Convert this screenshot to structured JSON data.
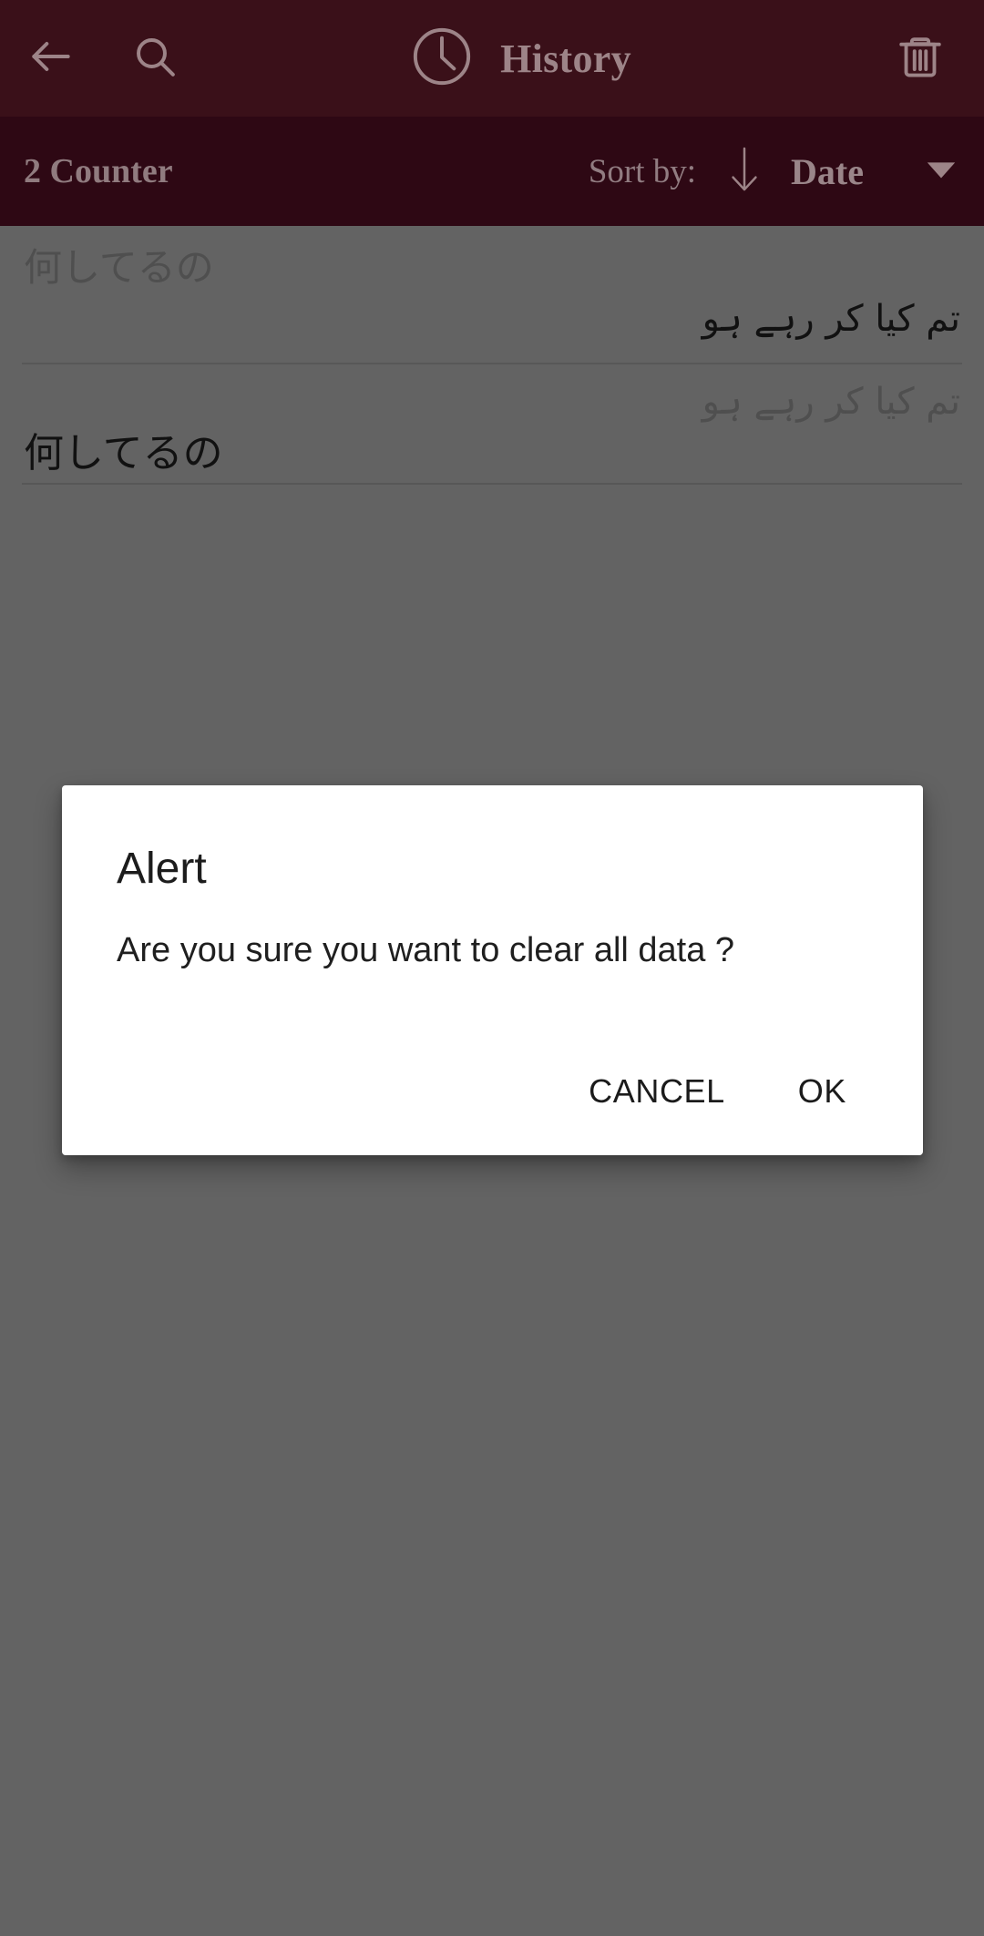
{
  "appbar": {
    "back_icon": "arrow-left-icon",
    "search_icon": "search-icon",
    "clock_icon": "clock-icon",
    "title": "History",
    "delete_icon": "trash-icon",
    "background_color": "#3a1019",
    "foreground_color": "#9d8488"
  },
  "sortbar": {
    "counter_label": "2 Counter",
    "sort_by_label": "Sort by:",
    "sort_direction_icon": "arrow-down-icon",
    "sort_value": "Date",
    "dropdown_icon": "caret-down-icon",
    "background_color": "#2e0814"
  },
  "history": {
    "rows": [
      {
        "source_text": "何してるの",
        "target_text": "تم کیا کر رہے ہو",
        "source_emphasis": "secondary",
        "target_emphasis": "primary"
      },
      {
        "source_text": "تم کیا کر رہے ہو",
        "target_text": "何してるの",
        "source_emphasis": "secondary",
        "target_emphasis": "primary"
      }
    ]
  },
  "dialog": {
    "title": "Alert",
    "message": "Are you sure you want to clear all data ?",
    "cancel_label": "CANCEL",
    "ok_label": "OK",
    "background_color": "#ffffff"
  },
  "scrim": {
    "color": "#636363"
  }
}
